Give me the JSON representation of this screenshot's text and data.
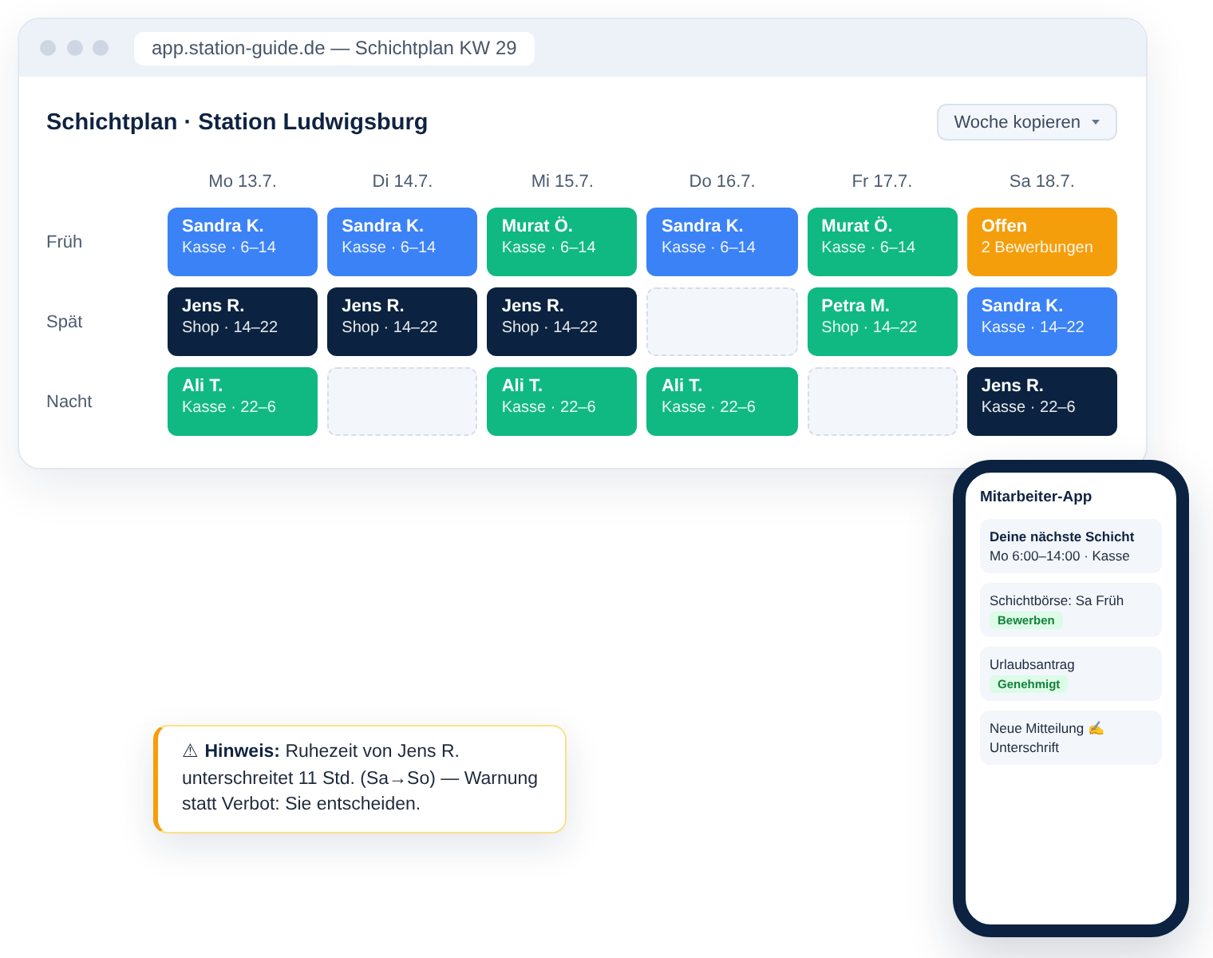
{
  "browser": {
    "url": "app.station-guide.de — Schichtplan KW 29"
  },
  "schedule": {
    "title": "Schichtplan · Station Ludwigsburg",
    "menu_button": {
      "label": "Woche kopieren"
    },
    "days": [
      "Mo 13.7.",
      "Di 14.7.",
      "Mi 15.7.",
      "Do 16.7.",
      "Fr 17.7.",
      "Sa 18.7."
    ],
    "rows": [
      {
        "label": "Früh",
        "shifts": [
          {
            "kind": "shift",
            "name": "Sandra K.",
            "detail": "Kasse · 6–14",
            "color": "#3b82f6"
          },
          {
            "kind": "shift",
            "name": "Sandra K.",
            "detail": "Kasse · 6–14",
            "color": "#3b82f6"
          },
          {
            "kind": "shift",
            "name": "Murat Ö.",
            "detail": "Kasse · 6–14",
            "color": "#10b981"
          },
          {
            "kind": "shift",
            "name": "Sandra K.",
            "detail": "Kasse · 6–14",
            "color": "#3b82f6"
          },
          {
            "kind": "shift",
            "name": "Murat Ö.",
            "detail": "Kasse · 6–14",
            "color": "#10b981"
          },
          {
            "kind": "shift",
            "name": "Offen",
            "detail": "2 Bewerbungen",
            "color": "#f59e0b"
          }
        ]
      },
      {
        "label": "Spät",
        "shifts": [
          {
            "kind": "shift",
            "name": "Jens R.",
            "detail": "Shop · 14–22",
            "color": "#0b2340"
          },
          {
            "kind": "shift",
            "name": "Jens R.",
            "detail": "Shop · 14–22",
            "color": "#0b2340"
          },
          {
            "kind": "shift",
            "name": "Jens R.",
            "detail": "Shop · 14–22",
            "color": "#0b2340"
          },
          {
            "kind": "empty"
          },
          {
            "kind": "shift",
            "name": "Petra M.",
            "detail": "Shop · 14–22",
            "color": "#10b981"
          },
          {
            "kind": "shift",
            "name": "Sandra K.",
            "detail": "Kasse · 14–22",
            "color": "#3b82f6"
          }
        ]
      },
      {
        "label": "Nacht",
        "shifts": [
          {
            "kind": "shift",
            "name": "Ali T.",
            "detail": "Kasse · 22–6",
            "color": "#10b981"
          },
          {
            "kind": "empty"
          },
          {
            "kind": "shift",
            "name": "Ali T.",
            "detail": "Kasse · 22–6",
            "color": "#10b981"
          },
          {
            "kind": "shift",
            "name": "Ali T.",
            "detail": "Kasse · 22–6",
            "color": "#10b981"
          },
          {
            "kind": "empty"
          },
          {
            "kind": "shift",
            "name": "Jens R.",
            "detail": "Kasse · 22–6",
            "color": "#0b2340"
          }
        ]
      }
    ]
  },
  "notice": {
    "text": "⚠ **Hinweis:** Ruhezeit von Jens R. unterschreitet 11 Std. (Sa→So) — Warnung statt Verbot: Sie entscheiden."
  },
  "phone": {
    "title": "Mitarbeiter-App",
    "cards": [
      {
        "kind": "next_shift",
        "title": "Deine nächste Schicht",
        "text": "Mo 6:00–14:00 · Kasse"
      },
      {
        "kind": "request",
        "text": "Schichtbörse: Sa Früh",
        "badge": "Bewerben"
      },
      {
        "kind": "request",
        "text": "Urlaubsantrag",
        "badge": "Genehmigt"
      },
      {
        "kind": "message",
        "text": "Neue Mitteilung ✍ Unterschrift"
      }
    ]
  }
}
